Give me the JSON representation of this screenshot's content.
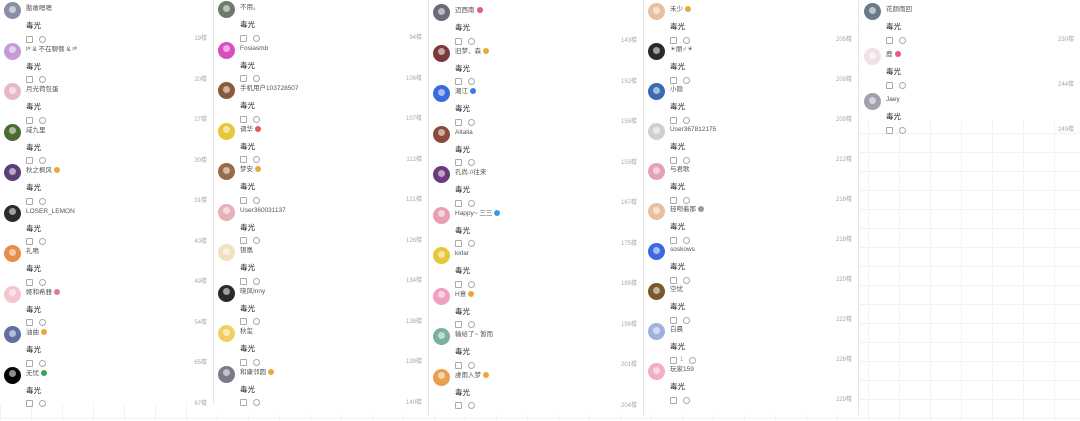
{
  "ui": {
    "grid_color": "#eef0ee",
    "accent": "#3aa64a"
  },
  "columns": [
    {
      "comments": [
        {
          "user": "憨敢嗯嗯",
          "text": "毒光",
          "floor": "19楼",
          "avatar_icon": "avatar-image-icon",
          "avatar_color": "#8a8fa8"
        },
        {
          "user": "ᵖᵏ & 不在聊惬 & ᵖᵏ",
          "text": "毒光",
          "floor": "20楼",
          "avatar_icon": "avatar-image-icon",
          "avatar_color": "#c79bd8"
        },
        {
          "user": "月光荷包蛋",
          "text": "毒光",
          "floor": "27楼",
          "avatar_icon": "avatar-image-icon",
          "avatar_color": "#e7b8c9"
        },
        {
          "user": "咸九里",
          "text": "毒光",
          "floor": "30楼",
          "avatar_icon": "avatar-image-icon",
          "avatar_color": "#4b6b2f"
        },
        {
          "user": "秋之枫风",
          "badge": "emoji-badge-icon",
          "badge_color": "#e8a93a",
          "text": "毒光",
          "floor": "31楼",
          "avatar_icon": "avatar-image-icon",
          "avatar_color": "#5a3f7a"
        },
        {
          "user": "LOSER_LEMON",
          "text": "毒光",
          "floor": "40楼",
          "avatar_icon": "avatar-image-icon",
          "avatar_color": "#2b2b2b"
        },
        {
          "user": "礼鳴",
          "text": "毒光",
          "floor": "49楼",
          "avatar_icon": "avatar-image-icon",
          "avatar_color": "#e98c4a"
        },
        {
          "user": "姬和希雅",
          "badge": "emoji-badge-icon",
          "badge_color": "#e07aa0",
          "text": "毒光",
          "floor": "54楼",
          "avatar_icon": "avatar-image-icon",
          "avatar_color": "#f2c6cc"
        },
        {
          "user": "油曲",
          "badge": "emoji-badge-icon",
          "badge_color": "#e8a93a",
          "text": "毒光",
          "floor": "65楼",
          "avatar_icon": "avatar-image-icon",
          "avatar_color": "#5f6f9f"
        },
        {
          "user": "无忧",
          "badge": "emoji-badge-icon",
          "badge_color": "#3aa64a",
          "text": "毒光",
          "floor": "67楼",
          "avatar_icon": "avatar-image-icon",
          "avatar_color": "#050505"
        }
      ]
    },
    {
      "comments": [
        {
          "user": "不用。",
          "text": "毒光",
          "floor": "94楼",
          "avatar_icon": "avatar-image-icon",
          "avatar_color": "#6c7b6c"
        },
        {
          "user": "Fosiasmb",
          "text": "毒光",
          "floor": "106楼",
          "avatar_icon": "avatar-image-icon",
          "avatar_color": "#d84ec0"
        },
        {
          "user": "手机用户103728507",
          "text": "毒光",
          "floor": "107楼",
          "avatar_icon": "avatar-image-icon",
          "avatar_color": "#8a5a3a"
        },
        {
          "user": "调华",
          "badge": "emoji-badge-icon",
          "badge_color": "#e85a5a",
          "text": "毒光",
          "floor": "112楼",
          "avatar_icon": "avatar-image-icon",
          "avatar_color": "#e8c63a"
        },
        {
          "user": "梦安",
          "badge": "emoji-badge-icon",
          "badge_color": "#e8a93a",
          "text": "毒光",
          "floor": "121楼",
          "avatar_icon": "avatar-image-icon",
          "avatar_color": "#9a6a4a"
        },
        {
          "user": "User360031137",
          "text": "毒光",
          "floor": "126楼",
          "avatar_icon": "avatar-image-icon",
          "avatar_color": "#e8b0b8"
        },
        {
          "user": "银凰",
          "text": "毒光",
          "floor": "134楼",
          "avatar_icon": "avatar-image-icon",
          "avatar_color": "#f0e2c0"
        },
        {
          "user": "晓风Inny",
          "text": "毒光",
          "floor": "138楼",
          "avatar_icon": "avatar-image-icon",
          "avatar_color": "#2a2a2a"
        },
        {
          "user": "秋玺",
          "text": "毒光",
          "floor": "139楼",
          "avatar_icon": "avatar-image-icon",
          "avatar_color": "#f0d060"
        },
        {
          "user": "和康邻圆",
          "badge": "emoji-badge-icon",
          "badge_color": "#e8a93a",
          "text": "毒光",
          "floor": "140楼",
          "avatar_icon": "avatar-image-icon",
          "avatar_color": "#7a7a8a"
        }
      ]
    },
    {
      "comments": [
        {
          "user": "迈西南",
          "badge": "emoji-badge-icon",
          "badge_color": "#e85a7a",
          "text": "毒光",
          "floor": "143楼",
          "avatar_icon": "avatar-image-icon",
          "avatar_color": "#6a6a7a"
        },
        {
          "user": "旧梦、森",
          "badge": "emoji-badge-icon",
          "badge_color": "#e8a93a",
          "text": "毒光",
          "floor": "152楼",
          "avatar_icon": "avatar-image-icon",
          "avatar_color": "#7a3a3a"
        },
        {
          "user": "潮江",
          "badge": "emoji-badge-icon",
          "badge_color": "#3a7ae8",
          "text": "毒光",
          "floor": "158楼",
          "avatar_icon": "avatar-image-icon",
          "avatar_color": "#3a6ae0"
        },
        {
          "user": "Altalia",
          "text": "毒光",
          "floor": "159楼",
          "avatar_icon": "avatar-image-icon",
          "avatar_color": "#8a4a3a"
        },
        {
          "user": "孔尚.//往来",
          "text": "毒光",
          "floor": "167楼",
          "avatar_icon": "avatar-image-icon",
          "avatar_color": "#6a3a7a"
        },
        {
          "user": "Happy~ 三三",
          "badge": "emoji-badge-icon",
          "badge_color": "#3a9ae8",
          "text": "毒光",
          "floor": "175楼",
          "avatar_icon": "avatar-image-icon",
          "avatar_color": "#e8a0b0"
        },
        {
          "user": "kirlar",
          "text": "毒光",
          "floor": "189楼",
          "avatar_icon": "avatar-image-icon",
          "avatar_color": "#e8c83a"
        },
        {
          "user": "H意",
          "badge": "emoji-badge-icon",
          "badge_color": "#e8a93a",
          "text": "毒光",
          "floor": "199楼",
          "avatar_icon": "avatar-image-icon",
          "avatar_color": "#f0a0c0"
        },
        {
          "user": "输给了~ 暂而",
          "text": "毒光",
          "floor": "201楼",
          "avatar_icon": "avatar-image-icon",
          "avatar_color": "#7ab0a0"
        },
        {
          "user": "虔雨入梦",
          "badge": "emoji-badge-icon",
          "badge_color": "#e8a93a",
          "text": "毒光",
          "floor": "204楼",
          "avatar_icon": "avatar-image-icon",
          "avatar_color": "#e8a050"
        }
      ]
    },
    {
      "comments": [
        {
          "user": "禾少",
          "badge": "emoji-badge-icon",
          "badge_color": "#e8a93a",
          "text": "毒光",
          "floor": "205楼",
          "avatar_icon": "avatar-image-icon",
          "avatar_color": "#e8c0a0"
        },
        {
          "user": "☀丽♂☀",
          "text": "毒光",
          "floor": "208楼",
          "avatar_icon": "avatar-image-icon",
          "avatar_color": "#2a2a2a"
        },
        {
          "user": "小隐",
          "text": "毒光",
          "floor": "209楼",
          "avatar_icon": "avatar-image-icon",
          "avatar_color": "#3a6ab0"
        },
        {
          "user": "User367812175",
          "text": "毒光",
          "floor": "212楼",
          "avatar_icon": "avatar-image-icon",
          "avatar_color": "#d0d0d0"
        },
        {
          "user": "与君歌",
          "text": "毒光",
          "floor": "216楼",
          "avatar_icon": "avatar-image-icon",
          "avatar_color": "#e8a0b8"
        },
        {
          "user": "轻吻着那",
          "badge": "emoji-badge-icon",
          "badge_color": "#9a9a9a",
          "text": "毒光",
          "floor": "218楼",
          "avatar_icon": "avatar-image-icon",
          "avatar_color": "#e8c0a0"
        },
        {
          "user": "soskows",
          "text": "毒光",
          "floor": "220楼",
          "avatar_icon": "avatar-image-icon",
          "avatar_color": "#3a6ae0"
        },
        {
          "user": "空忧",
          "text": "毒光",
          "floor": "222楼",
          "avatar_icon": "avatar-image-icon",
          "avatar_color": "#7a5a2a"
        },
        {
          "user": "白晨",
          "text": "毒光",
          "like_count": "1",
          "floor": "226楼",
          "avatar_icon": "avatar-image-icon",
          "avatar_color": "#a0b0e0"
        },
        {
          "user": "玩家159",
          "text": "毒光",
          "floor": "229楼",
          "avatar_icon": "avatar-image-icon",
          "avatar_color": "#f0b0c0"
        }
      ]
    },
    {
      "comments": [
        {
          "user": "花颜雨回",
          "text": "毒光",
          "floor": "230楼",
          "avatar_icon": "avatar-image-icon",
          "avatar_color": "#6a7a8a"
        },
        {
          "user": "鹿",
          "badge": "emoji-badge-icon",
          "badge_color": "#e85a7a",
          "text": "毒光",
          "floor": "244楼",
          "avatar_icon": "avatar-image-icon",
          "avatar_color": "#f0e0e8"
        },
        {
          "user": "Jaey",
          "text": "毒光",
          "floor": "249楼",
          "avatar_icon": "avatar-image-icon",
          "avatar_color": "#a0a0b0"
        }
      ]
    }
  ]
}
